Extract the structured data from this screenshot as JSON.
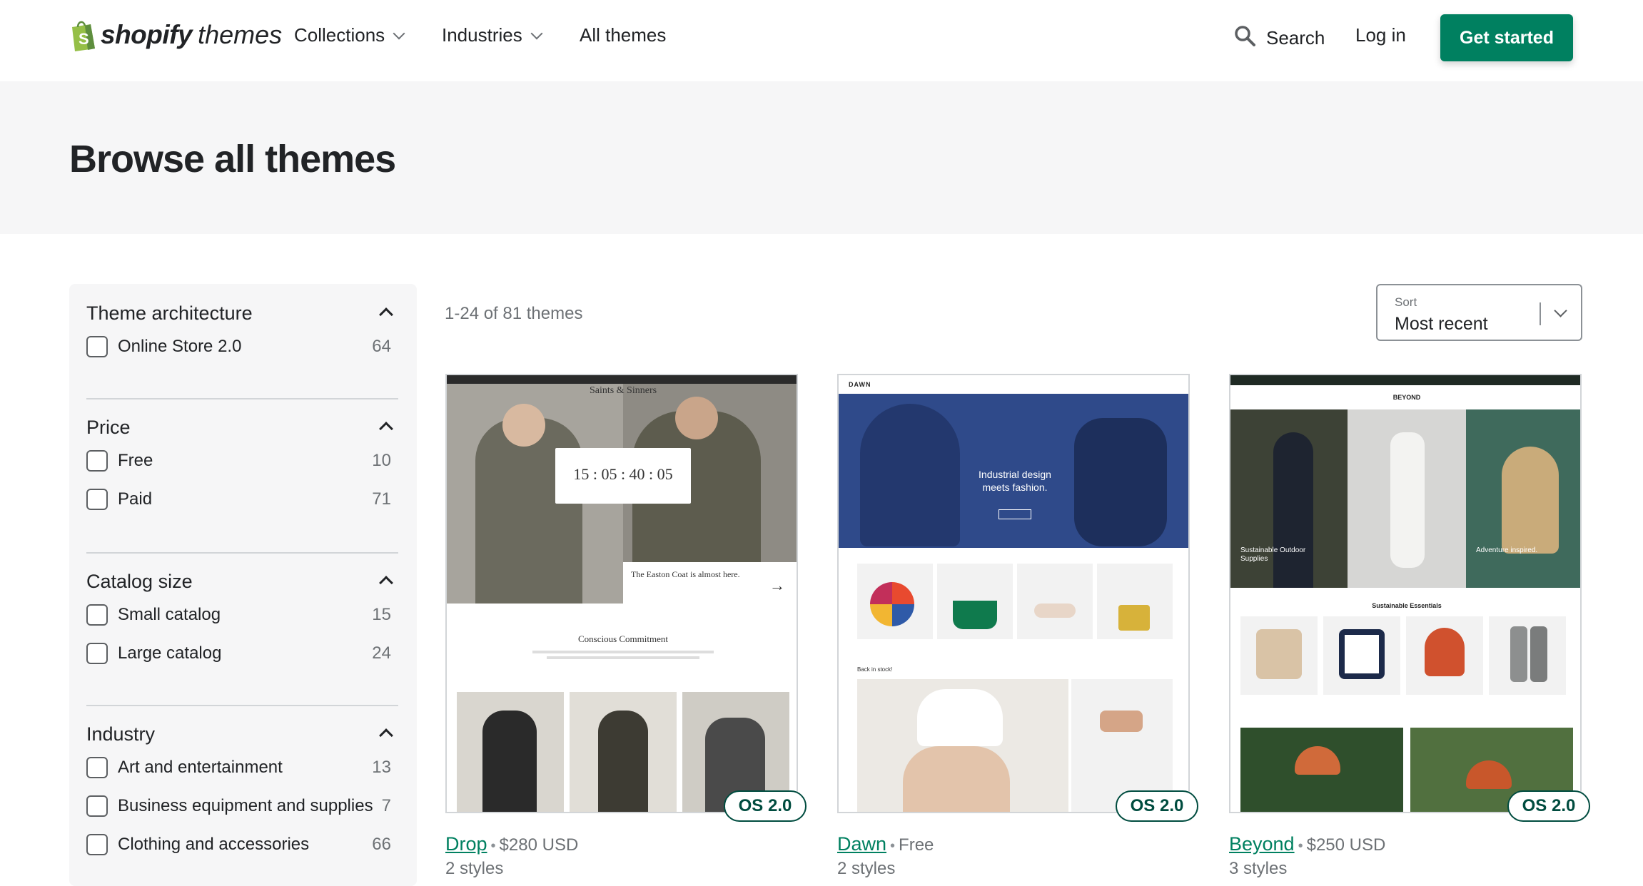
{
  "header": {
    "logo_strong": "shopify",
    "logo_light": "themes",
    "nav": [
      {
        "label": "Collections"
      },
      {
        "label": "Industries"
      },
      {
        "label": "All themes"
      }
    ],
    "search_label": "Search",
    "login_label": "Log in",
    "cta_label": "Get started"
  },
  "hero": {
    "title": "Browse all themes"
  },
  "filters": [
    {
      "title": "Theme architecture",
      "options": [
        {
          "label": "Online Store 2.0",
          "count": "64"
        }
      ]
    },
    {
      "title": "Price",
      "options": [
        {
          "label": "Free",
          "count": "10"
        },
        {
          "label": "Paid",
          "count": "71"
        }
      ]
    },
    {
      "title": "Catalog size",
      "options": [
        {
          "label": "Small catalog",
          "count": "15"
        },
        {
          "label": "Large catalog",
          "count": "24"
        }
      ]
    },
    {
      "title": "Industry",
      "options": [
        {
          "label": "Art and entertainment",
          "count": "13"
        },
        {
          "label": "Business equipment and supplies",
          "count": "7"
        },
        {
          "label": "Clothing and accessories",
          "count": "66"
        }
      ]
    }
  ],
  "results": {
    "count_text": "1-24 of 81 themes",
    "sort_label": "Sort",
    "sort_value": "Most recent"
  },
  "themes": [
    {
      "name": "Drop",
      "price": "$280 USD",
      "styles": "2 styles",
      "badge": "OS 2.0"
    },
    {
      "name": "Dawn",
      "price": "Free",
      "styles": "2 styles",
      "badge": "OS 2.0"
    },
    {
      "name": "Beyond",
      "price": "$250 USD",
      "styles": "3 styles",
      "badge": "OS 2.0"
    }
  ],
  "previews": {
    "drop": {
      "brand": "Saints & Sinners",
      "countdown": "15 : 05 : 40 : 05",
      "promo": "The Easton Coat is almost here.",
      "section": "Conscious Commitment"
    },
    "dawn": {
      "brand": "DAWN",
      "hero_line1": "Industrial design",
      "hero_line2": "meets fashion.",
      "back_in_stock": "Back in stock!"
    },
    "beyond": {
      "brand": "BEYOND",
      "left_caption": "Sustainable Outdoor Supplies",
      "right_caption": "Adventure inspired.",
      "section": "Sustainable Essentials"
    }
  },
  "colors": {
    "primary": "#008060",
    "badge": "#004c3f",
    "hero_bg": "#f6f6f7",
    "text": "#212326",
    "muted": "#6d7175"
  }
}
